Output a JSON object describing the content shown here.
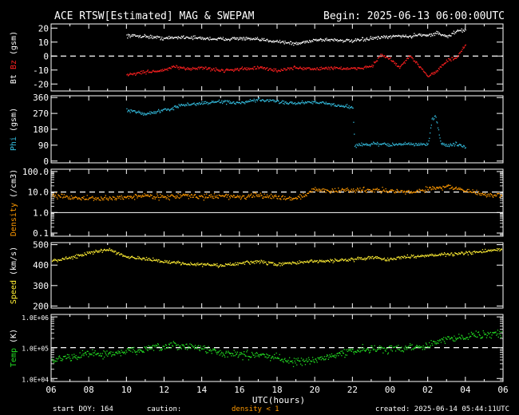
{
  "header": {
    "title": "ACE RTSW[Estimated] MAG & SWEPAM",
    "begin": "Begin: 2025-06-13 06:00:00UTC"
  },
  "footer": {
    "start_doy": "start DOY: 164",
    "caution_label": "caution:",
    "caution_value": "density < 1",
    "created": "created: 2025-06-14 05:44:11UTC",
    "xaxis_title": "UTC(hours)"
  },
  "colors": {
    "bt": "#ffffff",
    "bz": "#ff2020",
    "phi": "#33bbdd",
    "density": "#ff9900",
    "speed": "#ffee33",
    "temp": "#22dd22",
    "caution": "#ff9900"
  },
  "chart_data": {
    "type": "scatter",
    "x_unit": "hours since 2025-06-13 06:00 UTC",
    "xlim": [
      0,
      24
    ],
    "x_tick_labels": [
      "06",
      "08",
      "10",
      "12",
      "14",
      "16",
      "18",
      "20",
      "22",
      "00",
      "02",
      "04",
      "06"
    ],
    "data_start_hour": 4,
    "data_end_hour": 22,
    "panels": [
      {
        "id": "mag",
        "ylabel_part1": "Bt",
        "ylabel_part2": "Bz",
        "ylabel_unit": "(gsm)",
        "ylim": [
          -25,
          23
        ],
        "scale": "linear",
        "ticks": [
          20,
          10,
          0,
          -10,
          -20
        ],
        "tick_labels": [
          "20",
          "10",
          "0",
          "-10",
          "-20"
        ],
        "dashed_line": 0,
        "series": [
          {
            "key": "bt",
            "x": [
              4,
              5,
              6,
              7,
              8,
              9,
              10,
              11,
              12,
              13,
              14,
              15,
              16,
              17,
              18,
              18.5,
              19,
              19.5,
              20,
              20.5,
              21,
              21.5,
              22
            ],
            "y": [
              15,
              14.5,
              13,
              14,
              13,
              12.5,
              13,
              12,
              11,
              9,
              12,
              12,
              11,
              13,
              14,
              15,
              14,
              16,
              15,
              17,
              14,
              18,
              19
            ]
          },
          {
            "key": "bz",
            "x": [
              4,
              5,
              6,
              6.5,
              7,
              8,
              9,
              10,
              11,
              11.5,
              12,
              13,
              14,
              15,
              16,
              17,
              17.5,
              18,
              18.5,
              19,
              19.5,
              20,
              20.5,
              21,
              21.5,
              22
            ],
            "y": [
              -13,
              -11,
              -10,
              -7,
              -9,
              -8,
              -10,
              -9,
              -8,
              -9,
              -10,
              -8,
              -9,
              -8,
              -9,
              -7,
              1,
              -2,
              -8,
              0,
              -6,
              -14,
              -10,
              -3,
              -1,
              8
            ]
          }
        ]
      },
      {
        "id": "phi",
        "ylabel_part1": "Phi",
        "ylabel_unit": "(gsm)",
        "ylim": [
          -10,
          370
        ],
        "scale": "linear",
        "ticks": [
          360,
          270,
          180,
          90,
          0
        ],
        "tick_labels": [
          "360",
          "270",
          "180",
          "90",
          "0"
        ],
        "series": [
          {
            "key": "phi",
            "x": [
              4,
              5,
              6,
              7,
              8,
              9,
              10,
              11,
              12,
              13,
              14,
              15,
              16,
              16.1,
              17,
              18,
              19,
              19.5,
              20,
              20.2,
              20.4,
              20.7,
              21,
              21.5,
              22
            ],
            "y": [
              290,
              270,
              290,
              320,
              330,
              340,
              330,
              350,
              340,
              330,
              340,
              320,
              310,
              90,
              100,
              95,
              100,
              95,
              100,
              230,
              260,
              100,
              90,
              100,
              80
            ]
          }
        ]
      },
      {
        "id": "density",
        "ylabel_part1": "Density",
        "ylabel_unit": "(/cm3)",
        "ylim": [
          0.07,
          130
        ],
        "scale": "log",
        "ticks": [
          100,
          10,
          1,
          0.1
        ],
        "tick_labels": [
          "100.0",
          "10.0",
          "1.0",
          "0.1"
        ],
        "dashed_line": 10,
        "series": [
          {
            "key": "density",
            "x": [
              0,
              2,
              3,
              4,
              5,
              6,
              7,
              8,
              9,
              10,
              11,
              12,
              13,
              14,
              15,
              16,
              17,
              18,
              19,
              20,
              21,
              22,
              23,
              24
            ],
            "y": [
              7,
              5,
              5,
              6,
              7,
              6,
              7,
              6,
              7,
              6,
              7,
              6,
              5,
              14,
              12,
              13,
              14,
              12,
              10,
              15,
              20,
              12,
              8,
              7
            ]
          }
        ]
      },
      {
        "id": "speed",
        "ylabel_part1": "Speed",
        "ylabel_unit": "(km/s)",
        "ylim": [
          190,
          510
        ],
        "scale": "linear",
        "ticks": [
          500,
          400,
          300,
          200
        ],
        "tick_labels": [
          "500",
          "400",
          "300",
          "200"
        ],
        "series": [
          {
            "key": "speed",
            "x": [
              0,
              1,
              2,
              3,
              4,
              5,
              6,
              7,
              8,
              9,
              10,
              11,
              12,
              13,
              14,
              15,
              16,
              17,
              18,
              19,
              20,
              21,
              22,
              23,
              24
            ],
            "y": [
              420,
              440,
              460,
              480,
              445,
              430,
              420,
              410,
              405,
              400,
              410,
              420,
              405,
              415,
              420,
              425,
              430,
              440,
              430,
              445,
              450,
              455,
              460,
              470,
              480
            ]
          }
        ]
      },
      {
        "id": "temp",
        "ylabel_part1": "Temp",
        "ylabel_unit": "(K)",
        "ylim": [
          8000,
          1200000
        ],
        "scale": "log",
        "ticks": [
          1000000,
          100000,
          10000
        ],
        "tick_labels": [
          "1.0E+06",
          "1.0E+05",
          "1.0E+04"
        ],
        "dashed_line": 100000,
        "series": [
          {
            "key": "temp",
            "x": [
              0,
              1,
              2,
              3,
              4,
              5,
              6,
              7,
              8,
              9,
              10,
              11,
              12,
              13,
              14,
              15,
              16,
              17,
              18,
              19,
              20,
              21,
              22,
              23,
              24
            ],
            "y": [
              40000,
              50000,
              70000,
              60000,
              80000,
              90000,
              110000,
              120000,
              100000,
              70000,
              60000,
              60000,
              50000,
              35000,
              40000,
              60000,
              80000,
              100000,
              90000,
              110000,
              120000,
              200000,
              250000,
              280000,
              300000
            ]
          }
        ]
      }
    ]
  }
}
